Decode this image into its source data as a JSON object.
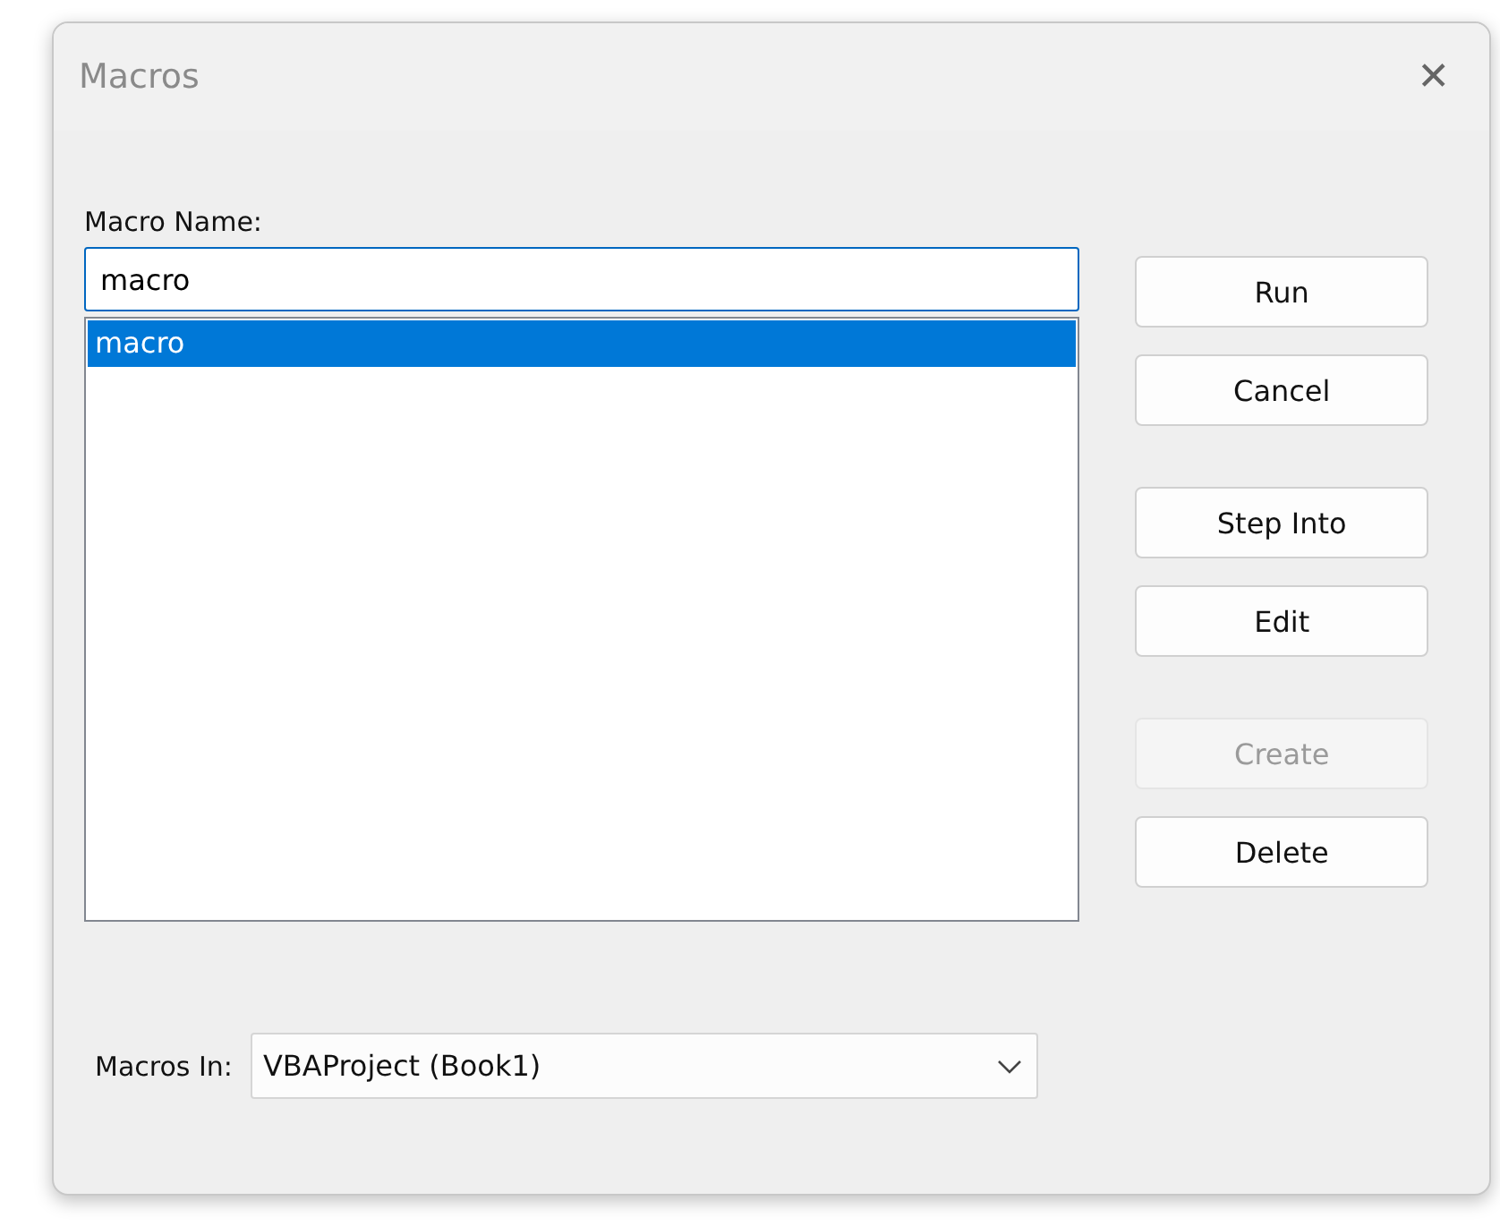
{
  "window": {
    "title": "Macros",
    "close": "✕"
  },
  "macro_name": {
    "label": "Macro Name:",
    "value": "macro"
  },
  "macro_list": [
    {
      "name": "macro",
      "selected": true
    }
  ],
  "button_groups": [
    [
      {
        "label": "Run",
        "disabled": false
      },
      {
        "label": "Cancel",
        "disabled": false
      }
    ],
    [
      {
        "label": "Step Into",
        "disabled": false
      },
      {
        "label": "Edit",
        "disabled": false
      }
    ],
    [
      {
        "label": "Create",
        "disabled": true
      },
      {
        "label": "Delete",
        "disabled": false
      }
    ]
  ],
  "macros_in": {
    "label": "Macros In:",
    "value": "VBAProject (Book1)"
  }
}
